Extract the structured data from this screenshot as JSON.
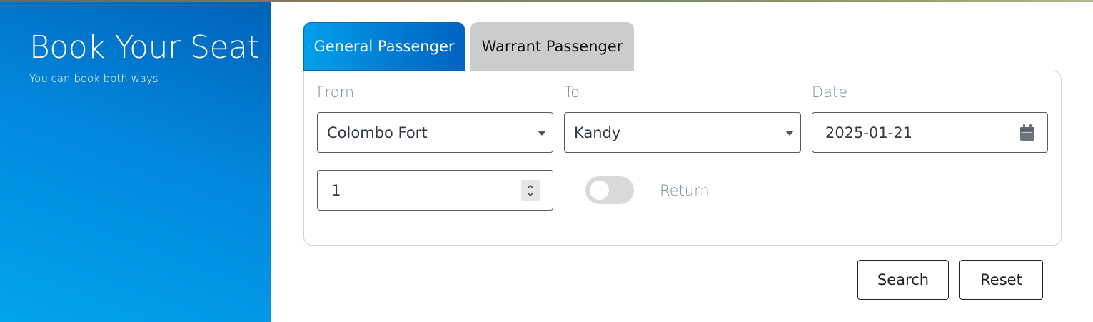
{
  "hero": {
    "title": "Book Your Seat",
    "subtitle": "You can book both ways",
    "gradient_colors": [
      "#0062b8",
      "#0287dc",
      "#02a4ee"
    ]
  },
  "tabs": [
    {
      "label": "General Passenger",
      "active": true
    },
    {
      "label": "Warrant Passenger",
      "active": false
    }
  ],
  "form": {
    "from": {
      "label": "From",
      "value": "Colombo Fort"
    },
    "to": {
      "label": "To",
      "value": "Kandy"
    },
    "date": {
      "label": "Date",
      "value": "2025-01-21",
      "icon": "calendar-icon"
    },
    "passengers": {
      "value": "1",
      "icon": "spinner-arrows-icon"
    },
    "return": {
      "label": "Return",
      "checked": false
    }
  },
  "actions": {
    "search_label": "Search",
    "reset_label": "Reset"
  },
  "colors": {
    "accent": "#0278d0",
    "inactive_tab": "#cccccc",
    "label_text": "#7d8c99"
  }
}
